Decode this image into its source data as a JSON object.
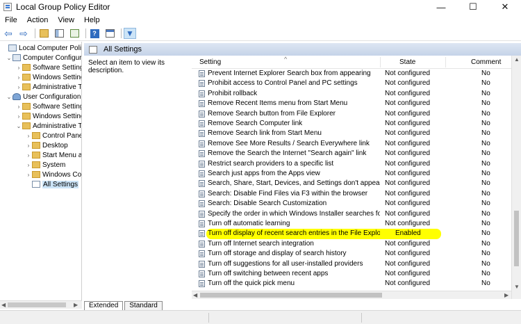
{
  "window": {
    "title": "Local Group Policy Editor",
    "minimize": "—",
    "maximize": "☐",
    "close": "✕"
  },
  "menu": [
    "File",
    "Action",
    "View",
    "Help"
  ],
  "toolbar": {
    "icons": [
      "back-arrow-icon",
      "forward-arrow-icon",
      "up-folder-icon",
      "show-hide-tree-icon",
      "export-list-icon",
      "help-icon",
      "properties-icon",
      "filter-icon"
    ]
  },
  "tree": {
    "items": [
      {
        "label": "Local Computer Policy",
        "icon": "computer-icon",
        "twisty": ""
      },
      {
        "label": "Computer Configura",
        "icon": "computer-icon",
        "twisty": "⌄"
      },
      {
        "label": "Software Settings",
        "icon": "folder-icon",
        "twisty": "›"
      },
      {
        "label": "Windows Setting",
        "icon": "folder-icon",
        "twisty": "›"
      },
      {
        "label": "Administrative Te",
        "icon": "folder-icon",
        "twisty": "›"
      },
      {
        "label": "User Configuration",
        "icon": "user-icon",
        "twisty": "⌄"
      },
      {
        "label": "Software Settings",
        "icon": "folder-icon",
        "twisty": "›"
      },
      {
        "label": "Windows Setting",
        "icon": "folder-icon",
        "twisty": "›"
      },
      {
        "label": "Administrative Te",
        "icon": "folder-icon",
        "twisty": "⌄"
      },
      {
        "label": "Control Panel",
        "icon": "folder-icon",
        "twisty": "›"
      },
      {
        "label": "Desktop",
        "icon": "folder-icon",
        "twisty": "›"
      },
      {
        "label": "Start Menu ar",
        "icon": "folder-icon",
        "twisty": "›"
      },
      {
        "label": "System",
        "icon": "folder-icon",
        "twisty": "›"
      },
      {
        "label": "Windows Cor",
        "icon": "folder-icon",
        "twisty": "›"
      },
      {
        "label": "All Settings",
        "icon": "settings-doc-icon",
        "twisty": "",
        "selected": true
      }
    ]
  },
  "header": {
    "title": "All Settings"
  },
  "description": "Select an item to view its description.",
  "columns": {
    "setting": "Setting",
    "state": "State",
    "comment": "Comment",
    "sort_indicator": "^"
  },
  "rows": [
    {
      "setting": "Prevent Internet Explorer Search box from appearing",
      "state": "Not configured",
      "comment": "No"
    },
    {
      "setting": "Prohibit access to Control Panel and PC settings",
      "state": "Not configured",
      "comment": "No"
    },
    {
      "setting": "Prohibit rollback",
      "state": "Not configured",
      "comment": "No"
    },
    {
      "setting": "Remove Recent Items menu from Start Menu",
      "state": "Not configured",
      "comment": "No"
    },
    {
      "setting": "Remove Search button from File Explorer",
      "state": "Not configured",
      "comment": "No"
    },
    {
      "setting": "Remove Search Computer link",
      "state": "Not configured",
      "comment": "No"
    },
    {
      "setting": "Remove Search link from Start Menu",
      "state": "Not configured",
      "comment": "No"
    },
    {
      "setting": "Remove See More Results / Search Everywhere link",
      "state": "Not configured",
      "comment": "No"
    },
    {
      "setting": "Remove the Search the Internet \"Search again\" link",
      "state": "Not configured",
      "comment": "No"
    },
    {
      "setting": "Restrict search providers to a specific list",
      "state": "Not configured",
      "comment": "No"
    },
    {
      "setting": "Search just apps from the Apps view",
      "state": "Not configured",
      "comment": "No"
    },
    {
      "setting": "Search, Share, Start, Devices, and Settings don't appear whe...",
      "state": "Not configured",
      "comment": "No"
    },
    {
      "setting": "Search: Disable Find Files via F3 within the browser",
      "state": "Not configured",
      "comment": "No"
    },
    {
      "setting": "Search: Disable Search Customization",
      "state": "Not configured",
      "comment": "No"
    },
    {
      "setting": "Specify the order in which Windows Installer searches for ins...",
      "state": "Not configured",
      "comment": "No"
    },
    {
      "setting": "Turn off automatic learning",
      "state": "Not configured",
      "comment": "No"
    },
    {
      "setting": "Turn off display of recent search entries in the File Explorer s...",
      "state": "Enabled",
      "comment": "No",
      "highlight": true
    },
    {
      "setting": "Turn off Internet search integration",
      "state": "Not configured",
      "comment": "No"
    },
    {
      "setting": "Turn off storage and display of search history",
      "state": "Not configured",
      "comment": "No"
    },
    {
      "setting": "Turn off suggestions for all user-installed providers",
      "state": "Not configured",
      "comment": "No"
    },
    {
      "setting": "Turn off switching between recent apps",
      "state": "Not configured",
      "comment": "No"
    },
    {
      "setting": "Turn off the quick pick menu",
      "state": "Not configured",
      "comment": "No"
    }
  ],
  "tabs": [
    "Extended",
    "Standard"
  ],
  "colors": {
    "highlight": "#ffff00",
    "header_bg": "#c5d3e8",
    "selection": "#cce4f7"
  }
}
